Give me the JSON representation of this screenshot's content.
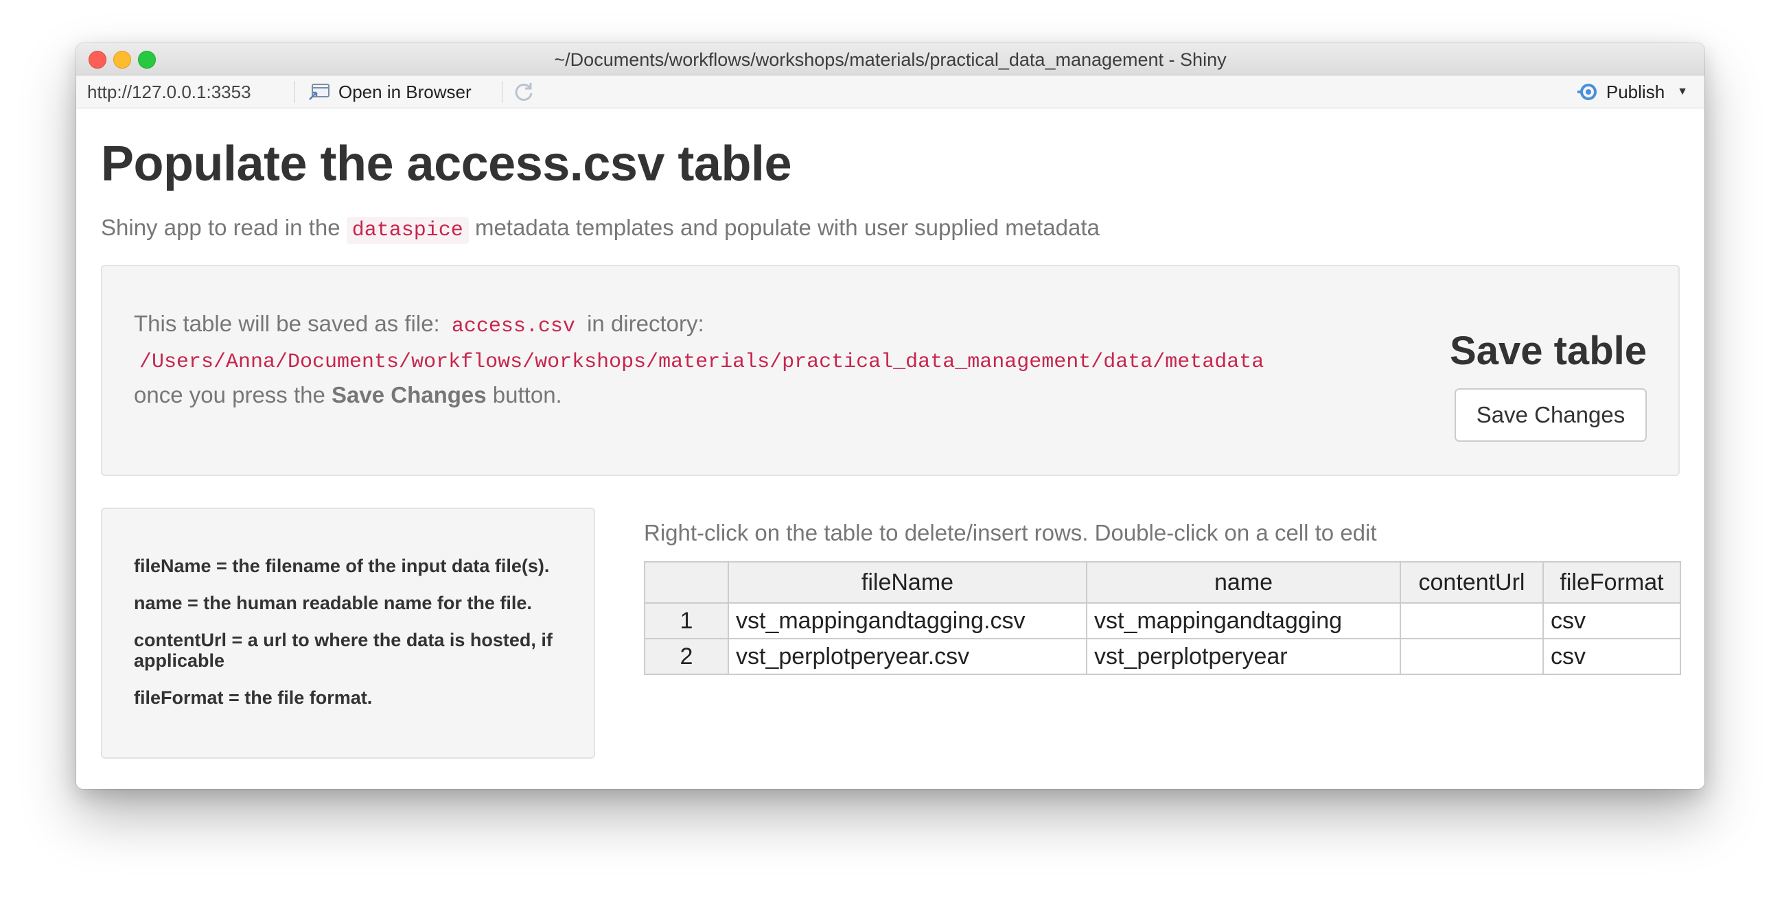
{
  "window": {
    "title": "~/Documents/workflows/workshops/materials/practical_data_management - Shiny"
  },
  "toolbar": {
    "url": "http://127.0.0.1:3353",
    "open_in_browser": "Open in Browser",
    "publish": "Publish"
  },
  "page": {
    "title": "Populate the access.csv table",
    "subtitle_prefix": "Shiny app to read in the ",
    "subtitle_code": "dataspice",
    "subtitle_suffix": " metadata templates and populate with user supplied metadata"
  },
  "info": {
    "line1_prefix": "This table will be saved as file: ",
    "file": "access.csv",
    "line1_suffix": " in directory:",
    "path": "/Users/Anna/Documents/workflows/workshops/materials/practical_data_management/data/metadata",
    "line3_prefix": "once you press the ",
    "line3_bold": "Save Changes",
    "line3_suffix": " button."
  },
  "save": {
    "heading": "Save table",
    "button": "Save Changes"
  },
  "definitions": [
    "fileName = the filename of the input data file(s).",
    "name = the human readable name for the file.",
    "contentUrl = a url to where the data is hosted, if applicable",
    "fileFormat = the file format."
  ],
  "table": {
    "caption": "Right-click on the table to delete/insert rows. Double-click on a cell to edit",
    "columns": [
      "",
      "fileName",
      "name",
      "contentUrl",
      "fileFormat"
    ],
    "rows": [
      [
        "1",
        "vst_mappingandtagging.csv",
        "vst_mappingandtagging",
        "",
        "csv"
      ],
      [
        "2",
        "vst_perplotperyear.csv",
        "vst_perplotperyear",
        "",
        "csv"
      ]
    ]
  }
}
